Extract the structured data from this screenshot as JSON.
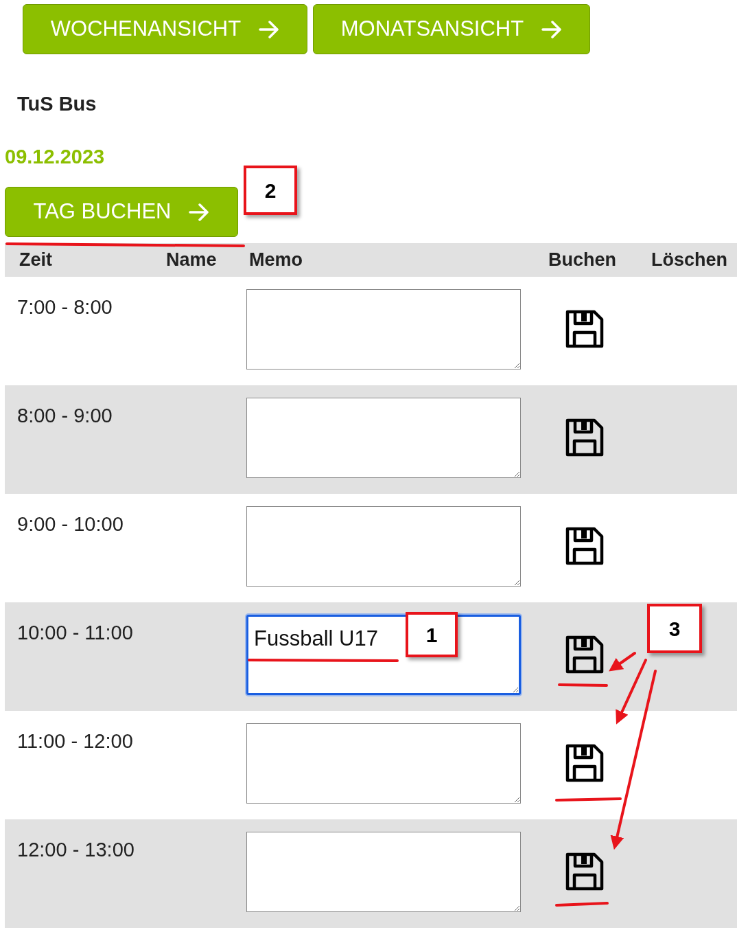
{
  "view_buttons": [
    {
      "label": "WOCHENANSICHT"
    },
    {
      "label": "MONATSANSICHT"
    }
  ],
  "resource": "TuS Bus",
  "date": "09.12.2023",
  "book_day_button": "TAG BUCHEN",
  "table": {
    "columns": [
      "Zeit",
      "Name",
      "Memo",
      "Buchen",
      "Löschen"
    ],
    "rows": [
      {
        "time": "7:00 - 8:00",
        "focused": false
      },
      {
        "time": "8:00 - 9:00",
        "focused": false
      },
      {
        "time": "9:00 - 10:00",
        "focused": false
      },
      {
        "time": "10:00 - 11:00",
        "memo": "Fussball U17",
        "focused": true
      },
      {
        "time": "11:00 - 12:00",
        "focused": false
      },
      {
        "time": "12:00 - 13:00",
        "focused": false
      }
    ]
  },
  "callouts": [
    {
      "label": "1"
    },
    {
      "label": "2"
    },
    {
      "label": "3"
    }
  ]
}
